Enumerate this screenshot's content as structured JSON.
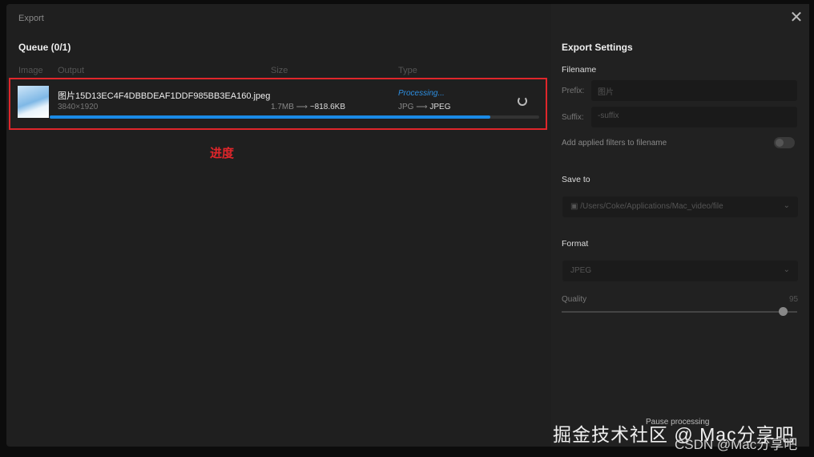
{
  "window": {
    "title": "Export",
    "close_icon": "close-icon"
  },
  "queue": {
    "title": "Queue (0/1)",
    "headers": [
      "Image",
      "Output",
      "Size",
      "Type"
    ],
    "items": [
      {
        "filename": "图片15D13EC4F4DBBDEAF1DDF985BB3EA160.jpeg",
        "dimensions": "3840×1920",
        "size_from": "1.7MB",
        "size_to": "~818.6KB",
        "status": "Processing...",
        "type_from": "JPG",
        "type_to": "JPEG",
        "progress": 0.9
      }
    ]
  },
  "annotation": "进度",
  "settings": {
    "title": "Export Settings",
    "filename_label": "Filename",
    "prefix_label": "Prefix:",
    "prefix_value": "图片",
    "suffix_label": "Suffix:",
    "suffix_placeholder": "-suffix",
    "filters_label": "Add applied filters to filename",
    "filters_on": false,
    "save_to_label": "Save to",
    "save_path": "/Users/Coke/Applications/Mac_video/file",
    "format_label": "Format",
    "format_value": "JPEG",
    "quality_label": "Quality",
    "quality_value": "95",
    "pause_label": "Pause processing"
  },
  "watermark": {
    "line1": "掘金技术社区 @ Mac分享吧",
    "line2": "CSDN @Mac分享吧"
  },
  "colors": {
    "accent": "#1a8ae6",
    "highlight": "#e0262b"
  }
}
